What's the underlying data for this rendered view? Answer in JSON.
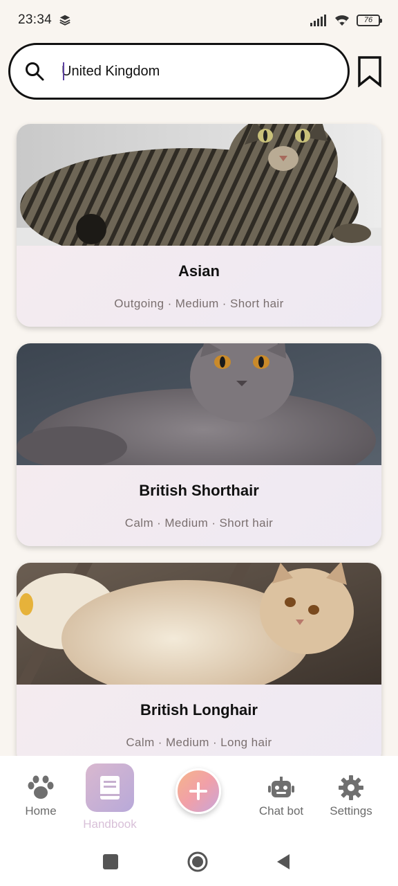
{
  "status_bar": {
    "time": "23:34",
    "battery": "76"
  },
  "search": {
    "value": "United Kingdom",
    "placeholder": ""
  },
  "breeds": [
    {
      "name": "Asian",
      "meta": "Outgoing · Medium · Short hair"
    },
    {
      "name": "British Shorthair",
      "meta": "Calm · Medium · Short hair"
    },
    {
      "name": "British Longhair",
      "meta": "Calm · Medium · Long hair"
    }
  ],
  "nav": {
    "home": "Home",
    "handbook": "Handbook",
    "chatbot": "Chat bot",
    "settings": "Settings"
  },
  "colors": {
    "background": "#f9f5f0",
    "card_gradient_start": "#f6ecee",
    "card_gradient_end": "#eee9f3",
    "nav_icon": "#6f6f6f",
    "active_tab_label": "#d8c0d8"
  }
}
